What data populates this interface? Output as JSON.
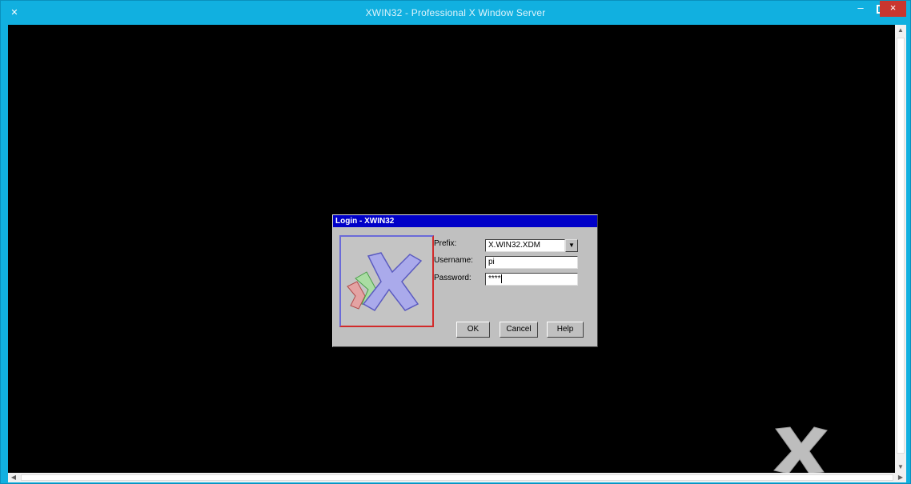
{
  "window": {
    "title": "XWIN32 - Professional X Window Server",
    "controls": {
      "minimize": "–",
      "close": "×"
    }
  },
  "dialog": {
    "title": "Login - XWIN32",
    "fields": {
      "prefix_label": "Prefix:",
      "prefix_value": "X.WIN32.XDM",
      "username_label": "Username:",
      "username_value": "pi",
      "password_label": "Password:",
      "password_value": "****"
    },
    "buttons": {
      "ok": "OK",
      "cancel": "Cancel",
      "help": "Help"
    }
  },
  "icons": {
    "app": "x-app-icon",
    "logo": "x-logo-icon",
    "dropdown": "chevron-down-icon"
  },
  "colors": {
    "window_frame": "#11b0e0",
    "client_bg": "#000000",
    "dialog_title_bg": "#0000c8",
    "dialog_bg": "#c0c0c0",
    "close_button": "#c9362f"
  }
}
